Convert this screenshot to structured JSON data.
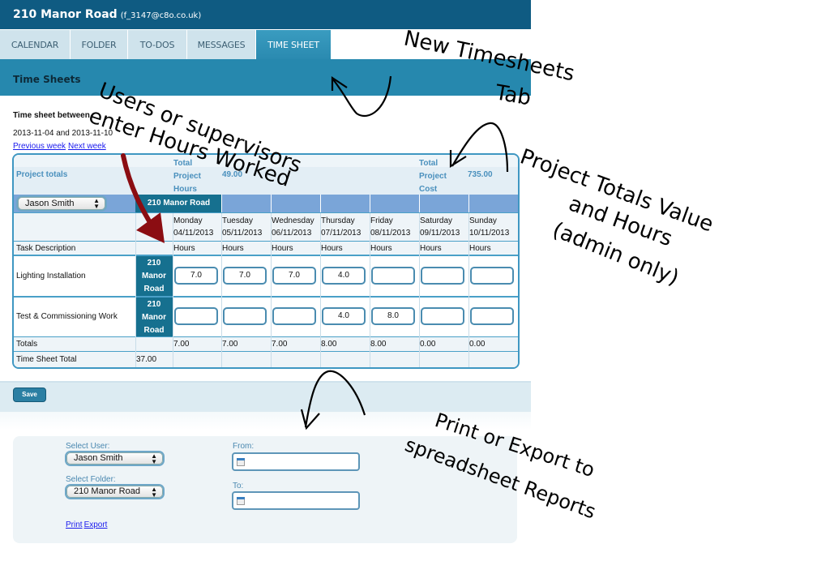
{
  "header": {
    "title": "210 Manor Road",
    "email": "(f_3147@c8o.co.uk)"
  },
  "tabs": [
    {
      "label": "CALENDAR",
      "active": false
    },
    {
      "label": "FOLDER",
      "active": false
    },
    {
      "label": "TO-DOS",
      "active": false
    },
    {
      "label": "MESSAGES",
      "active": false
    },
    {
      "label": "TIME SHEET",
      "active": true
    }
  ],
  "section": {
    "title": "Time Sheets"
  },
  "range": {
    "label": "Time sheet between",
    "dates": "2013-11-04 and 2013-11-10",
    "prev": "Previous week",
    "next": "Next week"
  },
  "grid": {
    "project_totals_label": "Project totals",
    "hours_label": [
      "Total",
      "Project",
      "Hours"
    ],
    "hours_value": "49.00",
    "cost_label": [
      "Total",
      "Project",
      "Cost"
    ],
    "cost_value": "735.00",
    "user_select": "Jason Smith",
    "project_header": "210 Manor Road",
    "days": [
      {
        "day": "Monday",
        "date": "04/11/2013"
      },
      {
        "day": "Tuesday",
        "date": "05/11/2013"
      },
      {
        "day": "Wednesday",
        "date": "06/11/2013"
      },
      {
        "day": "Thursday",
        "date": "07/11/2013"
      },
      {
        "day": "Friday",
        "date": "08/11/2013"
      },
      {
        "day": "Saturday",
        "date": "09/11/2013"
      },
      {
        "day": "Sunday",
        "date": "10/11/2013"
      }
    ],
    "task_header": "Task Description",
    "unit_label": "Hours",
    "tasks": [
      {
        "name": "Lighting Installation",
        "location": [
          "210",
          "Manor",
          "Road"
        ],
        "hours": [
          "7.0",
          "7.0",
          "7.0",
          "4.0",
          "",
          "",
          ""
        ]
      },
      {
        "name": "Test & Commissioning Work",
        "location": [
          "210",
          "Manor",
          "Road"
        ],
        "hours": [
          "",
          "",
          "",
          "4.0",
          "8.0",
          "",
          ""
        ]
      }
    ],
    "totals_label": "Totals",
    "totals": [
      "7.00",
      "7.00",
      "7.00",
      "8.00",
      "8.00",
      "0.00",
      "0.00"
    ],
    "sheet_total_label": "Time Sheet Total",
    "sheet_total": "37.00"
  },
  "save_label": "Save",
  "report": {
    "user_label": "Select User:",
    "user_value": "Jason Smith",
    "folder_label": "Select Folder:",
    "folder_value": "210 Manor Road",
    "from_label": "From:",
    "to_label": "To:",
    "from_value": "",
    "to_value": "",
    "print": "Print",
    "export": "Export"
  },
  "annotations": {
    "tab_note": [
      "New Timesheets",
      "Tab"
    ],
    "hours_note": [
      "Users or supervisors",
      "enter Hours Worked"
    ],
    "totals_note": [
      "Project Totals Value",
      "and Hours",
      "(admin only)"
    ],
    "report_note": [
      "Print or Export to",
      "spreadsheet Reports"
    ]
  }
}
